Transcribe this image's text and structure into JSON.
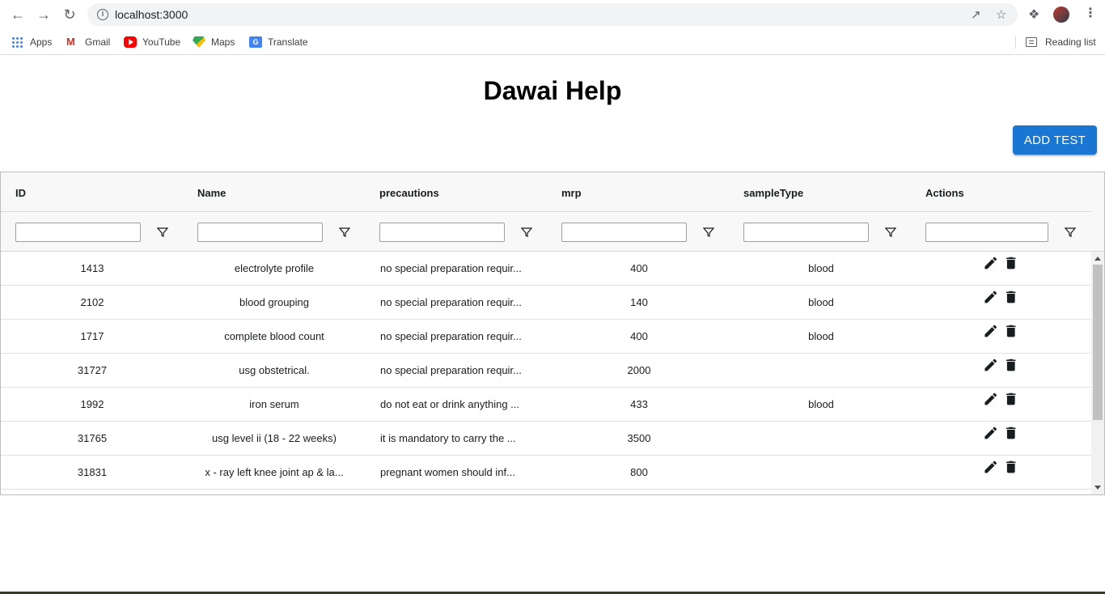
{
  "browser": {
    "url": "localhost:3000",
    "bookmarks": [
      {
        "label": "Apps",
        "icon": "apps-grid-icon"
      },
      {
        "label": "Gmail",
        "icon": "gmail-icon"
      },
      {
        "label": "YouTube",
        "icon": "youtube-icon"
      },
      {
        "label": "Maps",
        "icon": "maps-icon"
      },
      {
        "label": "Translate",
        "icon": "translate-icon"
      }
    ],
    "reading_list": "Reading list"
  },
  "page": {
    "title": "Dawai Help",
    "add_button": "ADD TEST"
  },
  "grid": {
    "columns": [
      "ID",
      "Name",
      "precautions",
      "mrp",
      "sampleType",
      "Actions"
    ],
    "rows": [
      {
        "id": "1413",
        "name": "electrolyte profile",
        "precautions": "no special preparation requir...",
        "mrp": "400",
        "sampleType": "blood"
      },
      {
        "id": "2102",
        "name": "blood grouping",
        "precautions": "no special preparation requir...",
        "mrp": "140",
        "sampleType": "blood"
      },
      {
        "id": "1717",
        "name": "complete blood count",
        "precautions": "no special preparation requir...",
        "mrp": "400",
        "sampleType": "blood"
      },
      {
        "id": "31727",
        "name": "usg obstetrical.",
        "precautions": "no special preparation requir...",
        "mrp": "2000",
        "sampleType": ""
      },
      {
        "id": "1992",
        "name": "iron serum",
        "precautions": "do not eat or drink anything ...",
        "mrp": "433",
        "sampleType": "blood"
      },
      {
        "id": "31765",
        "name": "usg level ii (18 - 22 weeks)",
        "precautions": "it is mandatory to carry the ...",
        "mrp": "3500",
        "sampleType": ""
      },
      {
        "id": "31831",
        "name": "x - ray left knee joint ap & la...",
        "precautions": "pregnant women should inf...",
        "mrp": "800",
        "sampleType": ""
      }
    ]
  },
  "colors": {
    "primary": "#1976d2",
    "header_bg": "#f8f8f8"
  }
}
